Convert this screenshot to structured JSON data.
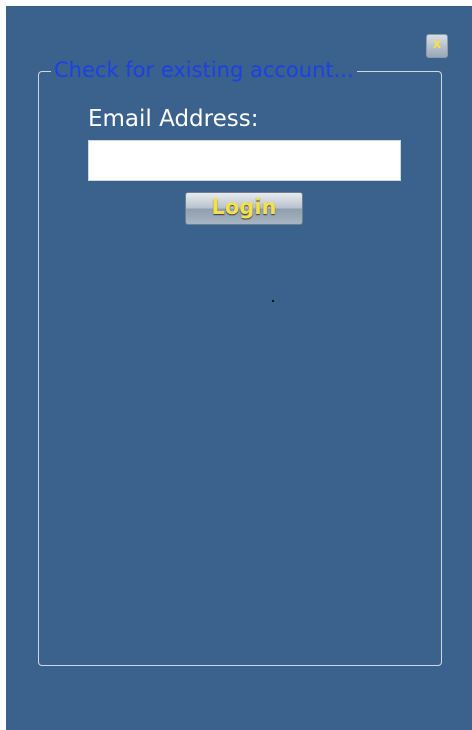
{
  "dialog": {
    "close_label": "x",
    "group_title": "Check for existing account...",
    "email_label": "Email Address:",
    "email_value": "",
    "login_label": "Login"
  },
  "colors": {
    "background": "#3b628c",
    "legend_text": "#1c40e6",
    "button_text": "#f4e04a",
    "label_text": "#ffffff"
  },
  "icons": {
    "close": "close-icon"
  }
}
